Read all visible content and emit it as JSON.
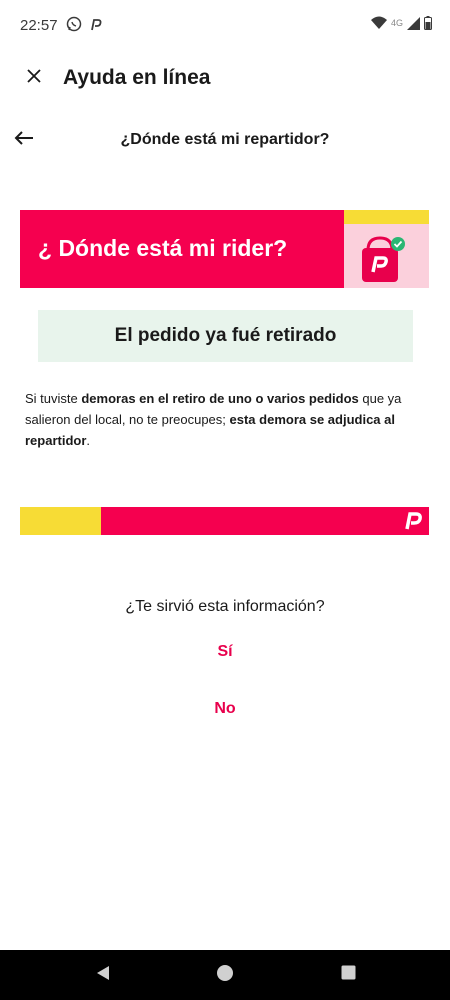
{
  "status_bar": {
    "time": "22:57",
    "network_label": "4G",
    "icons": [
      "whatsapp-icon",
      "pedidosya-icon",
      "wifi-icon",
      "signal-icon",
      "battery-icon"
    ]
  },
  "app_bar": {
    "title": "Ayuda en línea",
    "close_icon": "close-icon"
  },
  "sub_header": {
    "title": "¿Dónde está mi repartidor?",
    "back_icon": "arrow-left-icon"
  },
  "banner": {
    "title": "¿ Dónde está mi rider?",
    "illustration": "delivery-bag-icon"
  },
  "info_box": {
    "text": "El pedido ya fué retirado"
  },
  "description": {
    "p1": "Si tuviste ",
    "b1": "demoras en el retiro de uno o varios pedidos",
    "p2": " que ya salieron del local, no te preocupes; ",
    "b2": "esta demora se adjudica al repartidor",
    "p3": "."
  },
  "feedback": {
    "question": "¿Te sirvió esta información?",
    "yes_label": "Sí",
    "no_label": "No"
  },
  "colors": {
    "brand": "#f5004f",
    "accent_yellow": "#f7dc35",
    "info_bg": "#e8f4ec",
    "link": "#e8004c"
  },
  "nav": {
    "icons": [
      "back-triangle-icon",
      "home-circle-icon",
      "recents-square-icon"
    ]
  }
}
